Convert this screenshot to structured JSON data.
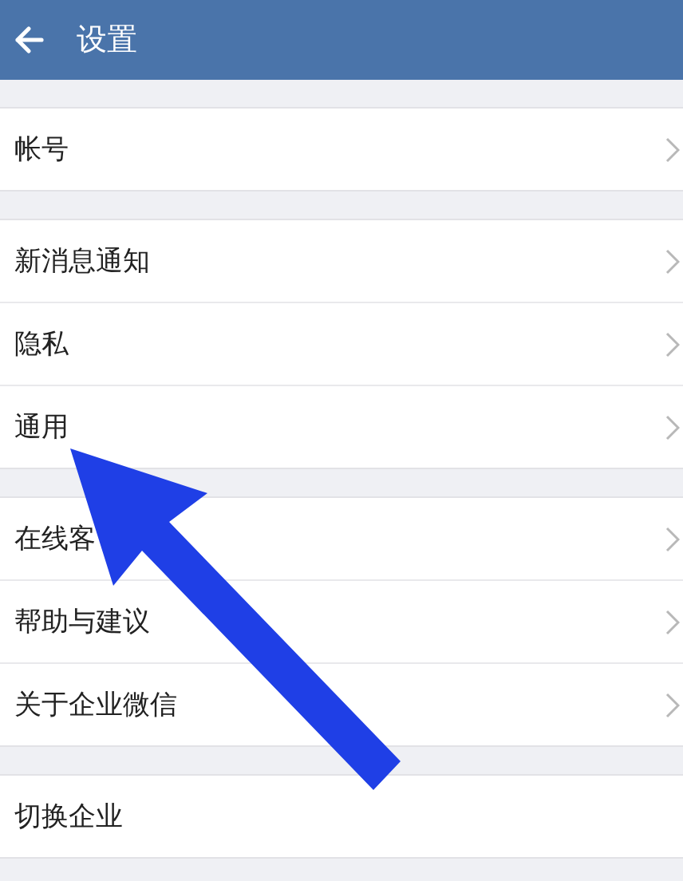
{
  "header": {
    "title": "设置"
  },
  "groups": [
    {
      "items": [
        {
          "label": "帐号",
          "chevron": true
        }
      ]
    },
    {
      "items": [
        {
          "label": "新消息通知",
          "chevron": true
        },
        {
          "label": "隐私",
          "chevron": true
        },
        {
          "label": "通用",
          "chevron": true
        }
      ]
    },
    {
      "items": [
        {
          "label": "在线客",
          "chevron": true
        },
        {
          "label": "帮助与建议",
          "chevron": true
        },
        {
          "label": "关于企业微信",
          "chevron": true
        }
      ]
    },
    {
      "items": [
        {
          "label": "切换企业",
          "chevron": false
        }
      ]
    }
  ]
}
